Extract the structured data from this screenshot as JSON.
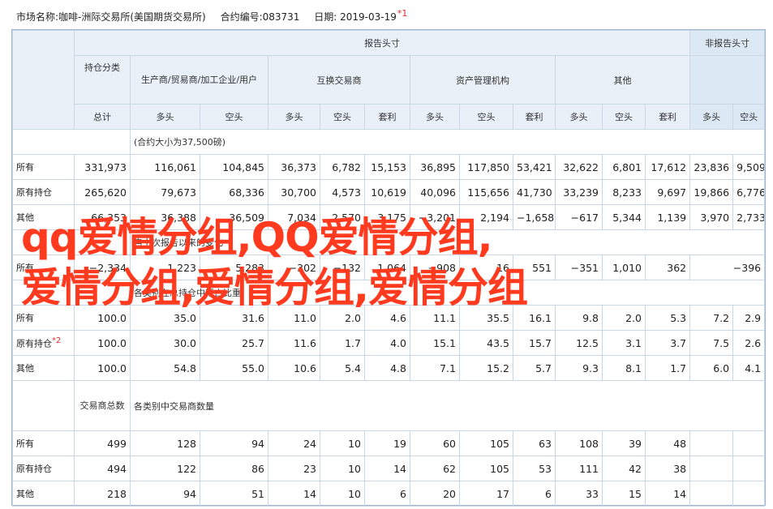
{
  "header": {
    "market": "市场名称:咖啡-洲际交易所(美国期货交易所)",
    "code": "合约编号:083731",
    "date": "日期: 2019-03-19",
    "date_mark": "*1"
  },
  "table": {
    "group_report": "报告头寸",
    "group_nonreport": "非报告头寸",
    "holding_class": "持仓分类",
    "cat_producer": "生产商/贸易商/加工企业/用户",
    "cat_swap": "互换交易商",
    "cat_asset": "资产管理机构",
    "cat_other": "其他",
    "total": "总计",
    "long": "多头",
    "short": "空头",
    "spread": "套利",
    "sec_contract": "(合约大小为37,500磅)",
    "sec_change": "自上次报告以来的变化",
    "sec_percent": "各类别在总持仓中所占比重",
    "trader_total": "交易商总数",
    "sec_traders": "各类别中交易商数量",
    "mark2": "*2",
    "rows": [
      {
        "label": "所有",
        "cells": [
          "331,973",
          "116,061",
          "104,845",
          "36,373",
          "6,782",
          "15,153",
          "36,895",
          "117,850",
          "53,421",
          "32,622",
          "6,801",
          "17,612",
          "23,836",
          "9,509"
        ]
      },
      {
        "label": "原有持仓",
        "cells": [
          "265,620",
          "79,673",
          "68,336",
          "30,700",
          "4,573",
          "10,619",
          "40,096",
          "115,656",
          "41,730",
          "33,239",
          "8,233",
          "9,697",
          "19,866",
          "6,776"
        ]
      },
      {
        "label": "其他",
        "cells": [
          "66,353",
          "36,388",
          "36,509",
          "7,034",
          "2,570",
          "3,175",
          "−3,201",
          "2,194",
          "−1,658",
          "−617",
          "5,344",
          "1,139",
          "3,970",
          "2,733"
        ]
      },
      {
        "label": "所有",
        "cells": [
          "−2,334",
          "1,223",
          "5,283",
          "−302",
          "−132",
          "1,064",
          "−908",
          "16",
          "551",
          "−351",
          "1,010",
          "362",
          "−396"
        ]
      },
      {
        "label": "所有",
        "cells": [
          "100.0",
          "35.0",
          "31.6",
          "11.0",
          "2.0",
          "4.6",
          "11.1",
          "35.5",
          "16.1",
          "9.8",
          "2.0",
          "5.3",
          "7.2",
          "2.9"
        ]
      },
      {
        "label": "原有持仓",
        "cells": [
          "100.0",
          "30.0",
          "25.7",
          "11.6",
          "1.7",
          "4.0",
          "15.1",
          "43.5",
          "15.7",
          "12.5",
          "3.1",
          "3.7",
          "7.5",
          "2.6"
        ]
      },
      {
        "label": "其他",
        "cells": [
          "100.0",
          "54.8",
          "55.0",
          "10.6",
          "5.4",
          "4.8",
          "7.1",
          "15.2",
          "5.7",
          "9.3",
          "8.1",
          "1.7",
          "6.0",
          "4.1"
        ]
      },
      {
        "label": "所有",
        "cells": [
          "499",
          "128",
          "94",
          "24",
          "10",
          "19",
          "60",
          "105",
          "63",
          "108",
          "39",
          "48"
        ]
      },
      {
        "label": "原有持仓",
        "cells": [
          "494",
          "122",
          "86",
          "23",
          "10",
          "14",
          "62",
          "105",
          "53",
          "111",
          "42",
          "38"
        ]
      },
      {
        "label": "其他",
        "cells": [
          "218",
          "94",
          "51",
          "14",
          "10",
          "6",
          "20",
          "17",
          "6",
          "33",
          "15",
          "14"
        ]
      }
    ]
  },
  "watermark": {
    "line1": "qq爱情分组,QQ爱情分组,",
    "line2": "爱情分组,爱情分组,爱情分组"
  }
}
